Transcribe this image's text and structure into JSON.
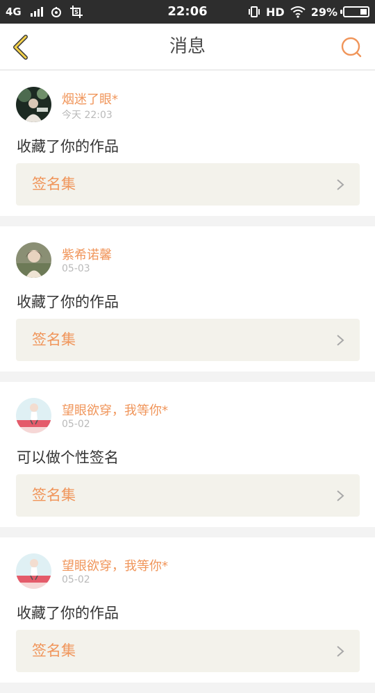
{
  "status_bar": {
    "network": "4G",
    "time": "22:06",
    "hd": "HD",
    "battery_percent": "29%",
    "battery_level": 0.29
  },
  "header": {
    "title": "消息",
    "accent_color": "#f0955a"
  },
  "messages": [
    {
      "username": "烟迷了眼*",
      "date": "今天 22:03",
      "text": "收藏了你的作品",
      "link_label": "签名集"
    },
    {
      "username": "紫希诺馨",
      "date": "05-03",
      "text": "收藏了你的作品",
      "link_label": "签名集"
    },
    {
      "username": "望眼欲穿，我等你*",
      "date": "05-02",
      "text": "可以做个性签名",
      "link_label": "签名集"
    },
    {
      "username": "望眼欲穿，我等你*",
      "date": "05-02",
      "text": "收藏了你的作品",
      "link_label": "签名集"
    }
  ]
}
